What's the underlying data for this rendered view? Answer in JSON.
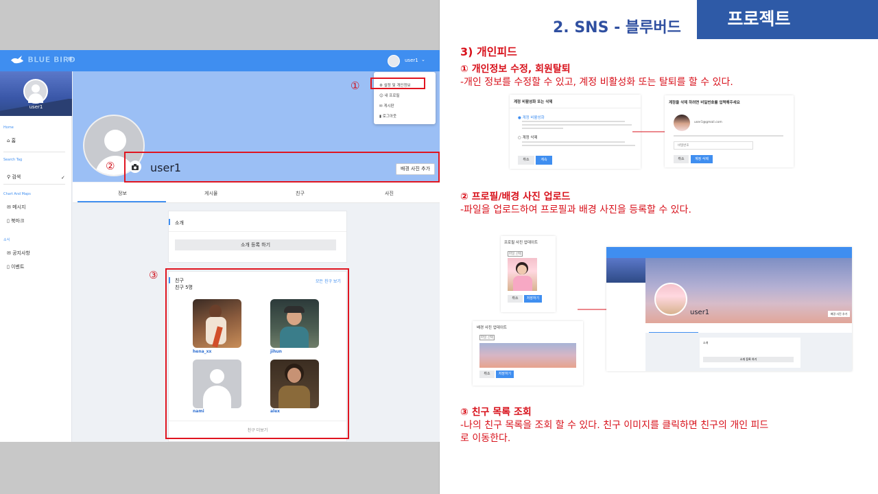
{
  "header": {
    "title": "2. SNS - 블루버드",
    "badge": "프로젝트"
  },
  "app": {
    "logo": "BLUE BIRD",
    "menu_icon": "≡",
    "user_name": "user1",
    "sidebar": {
      "user_name": "user1",
      "sections": [
        "Home",
        "Search Tag",
        "Chart And Maps",
        "소식"
      ],
      "items": [
        "홈",
        "검색",
        "메시지",
        "북마크",
        "공지사항",
        "이벤트"
      ]
    },
    "dropdown": {
      "items": [
        "설정 및 개인정보",
        "내 프로필",
        "게시판",
        "로그아웃"
      ]
    },
    "profile": {
      "nickname": "user1",
      "bg_button": "배경 사진 추가"
    },
    "tabs": [
      "정보",
      "게시물",
      "친구",
      "사진"
    ],
    "intro": {
      "title": "소개",
      "button": "소개 등록 하기"
    },
    "friends": {
      "title": "친구",
      "count": "친구 5명",
      "see_all": "모든 친구 보기",
      "list": [
        "hena_xx",
        "jihun",
        "nami",
        "alex"
      ],
      "more": "친구 더보기"
    },
    "markers": [
      "①",
      "②",
      "③"
    ]
  },
  "right": {
    "section_title": "3) 개인피드",
    "item1": {
      "title": "① 개인정보 수정, 회원탈퇴",
      "desc": "-개인 정보를 수정할 수 있고, 계정 비활성화 또는 탈퇴를 할 수 있다."
    },
    "item2": {
      "title": "② 프로필/배경 사진 업로드",
      "desc": "-파일을 업로드하여 프로필과 배경 사진을 등록할 수 있다."
    },
    "item3": {
      "title": "③ 친구 목록 조회",
      "desc_line1": "-나의 친구 목록을 조회 할 수 있다. 친구 이미지를 클릭하면 친구의 개인 피드",
      "desc_line2": "로 이동한다."
    },
    "shot_deactivate": {
      "title": "계정 비활성화 또는 삭제",
      "opt1": "계정 비활성화",
      "opt2": "계정 삭제",
      "cancel": "취소",
      "next": "계속"
    },
    "shot_delete": {
      "title": "계정을 삭제 하려면 비밀번호를 입력해주세요",
      "email": "user1@gmail.com",
      "placeholder": "비밀번호",
      "cancel": "취소",
      "confirm": "계정 삭제"
    },
    "shot_profile_upload": {
      "title": "프로필 사진 업데이트",
      "file_btn": "파일 선택",
      "cancel": "취소",
      "save": "저장하기"
    },
    "shot_bg_upload": {
      "title": "배경 사진 업데이트",
      "file_btn": "파일 선택",
      "cancel": "취소",
      "save": "저장하기"
    },
    "shot_feed": {
      "nickname": "user1",
      "bg_button": "배경 사진 추가",
      "intro": "소개",
      "intro_btn": "소개 등록 하기"
    }
  },
  "colors": {
    "primary": "#3f8ef0",
    "accent_red": "#d8111b",
    "header_blue": "#2e5aa7"
  }
}
